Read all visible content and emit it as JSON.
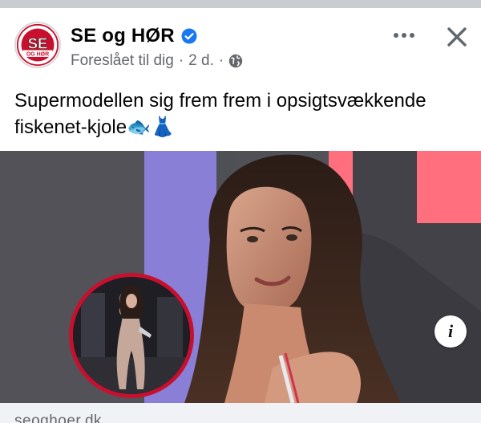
{
  "post": {
    "page_name": "SE og HØR",
    "avatar_text": "SE og HØR",
    "meta": {
      "label": "Foreslået til dig",
      "separator": "·",
      "time": "2 d.",
      "separator2": "·"
    },
    "text": "Supermodellen sig frem frem i opsigtsvækkende fiskenet-kjole",
    "text_emojis": "🐟👗",
    "link_domain": "seoghoer.dk"
  },
  "icons": {
    "verified": "verified-badge-icon",
    "globe": "globe-icon",
    "more": "more-options-icon",
    "close": "close-icon",
    "info": "info-icon"
  },
  "info_glyph": "i",
  "colors": {
    "accent_red": "#c8102e",
    "verified_blue": "#1877f2",
    "meta_gray": "#65676b"
  }
}
